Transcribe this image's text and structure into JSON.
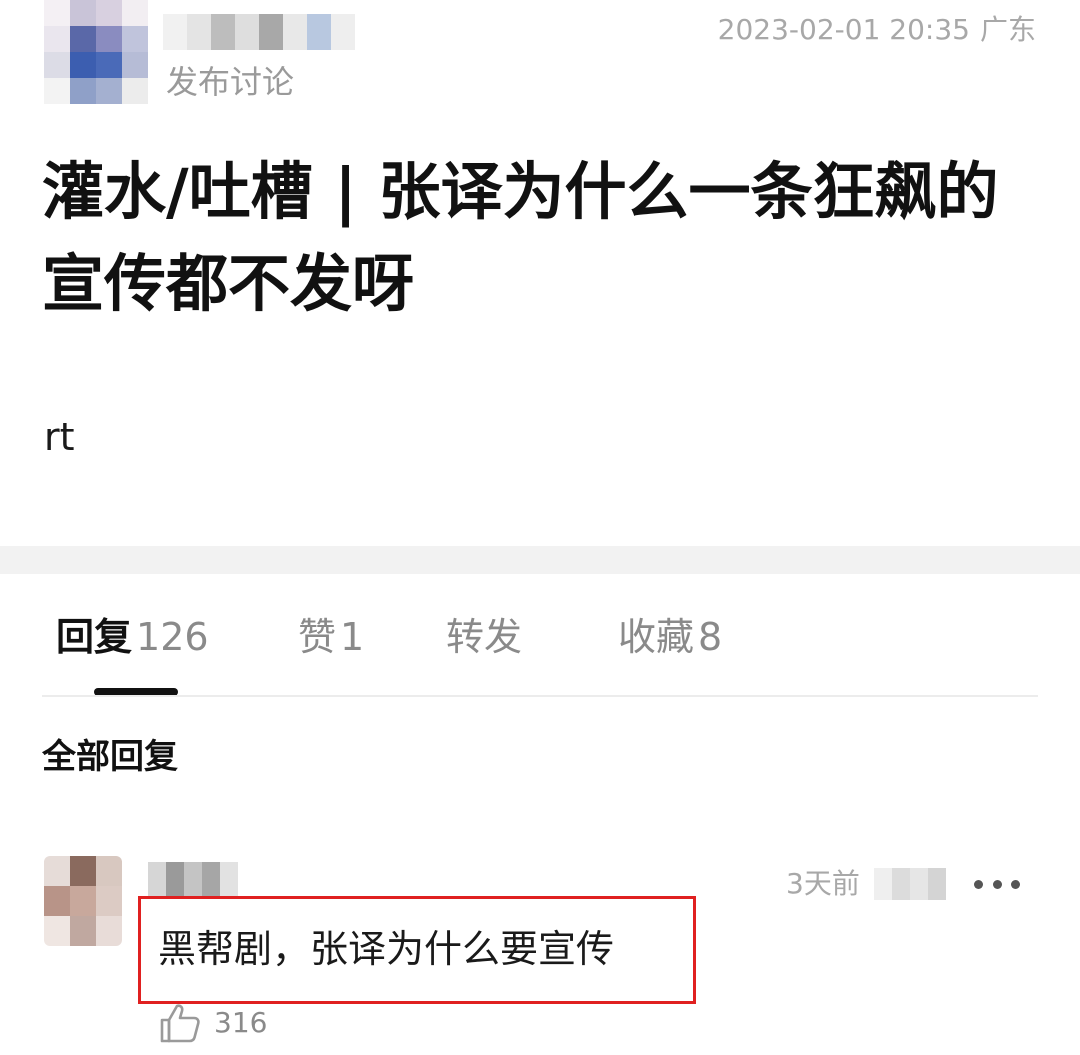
{
  "post": {
    "author_avatar_icon": "avatar-icon",
    "type": "发布讨论",
    "timestamp": "2023-02-01 20:35",
    "region": "广东",
    "title": "灌水/吐槽 | 张译为什么一条狂飙的宣传都不发呀",
    "body": "rt"
  },
  "tabs": [
    {
      "label": "回复",
      "count": "126",
      "active": true
    },
    {
      "label": "赞",
      "count": "1",
      "active": false
    },
    {
      "label": "转发",
      "count": "",
      "active": false
    },
    {
      "label": "收藏",
      "count": "8",
      "active": false
    }
  ],
  "section_heading": "全部回复",
  "comment": {
    "time": "3天前",
    "text": "黑帮剧，张译为什么要宣传",
    "like_count": "316",
    "like_icon": "thumbs-up-icon",
    "more_icon": "more-icon",
    "highlight_color": "#e02020"
  },
  "colors": {
    "text_primary": "#111111",
    "text_secondary": "#8a8a8a",
    "separator": "#f2f2f2"
  }
}
